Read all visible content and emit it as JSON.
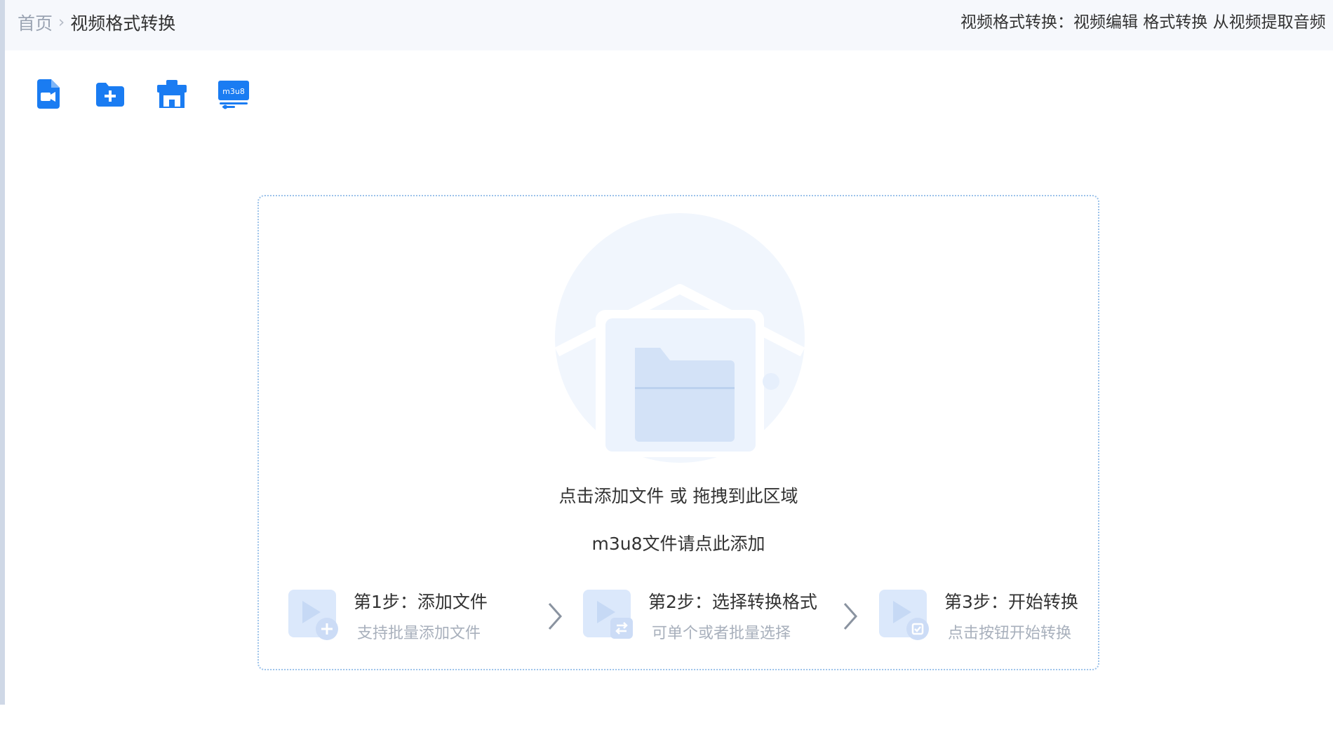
{
  "breadcrumb": {
    "home": "首页",
    "separator": "›",
    "current": "视频格式转换"
  },
  "header": {
    "description": "视频格式转换：视频编辑 格式转换 从视频提取音频"
  },
  "toolbar": {
    "buttons": [
      {
        "icon": "add-video-file-icon"
      },
      {
        "icon": "add-folder-icon"
      },
      {
        "icon": "batch-import-icon"
      },
      {
        "icon": "m3u8-icon",
        "badge": "m3u8"
      }
    ]
  },
  "drop_zone": {
    "main_text": "点击添加文件 或 拖拽到此区域",
    "m3u8_text": "m3u8文件请点此添加"
  },
  "steps": [
    {
      "title": "第1步：添加文件",
      "desc": "支持批量添加文件",
      "icon": "add-step-icon"
    },
    {
      "title": "第2步：选择转换格式",
      "desc": "可单个或者批量选择",
      "icon": "convert-step-icon"
    },
    {
      "title": "第3步：开始转换",
      "desc": "点击按钮开始转换",
      "icon": "start-step-icon"
    }
  ],
  "colors": {
    "accent": "#1a7cf2",
    "drop_border": "#9cc2ea",
    "muted_text": "#a8b0bc",
    "topbar_bg": "#f6f8fc"
  }
}
